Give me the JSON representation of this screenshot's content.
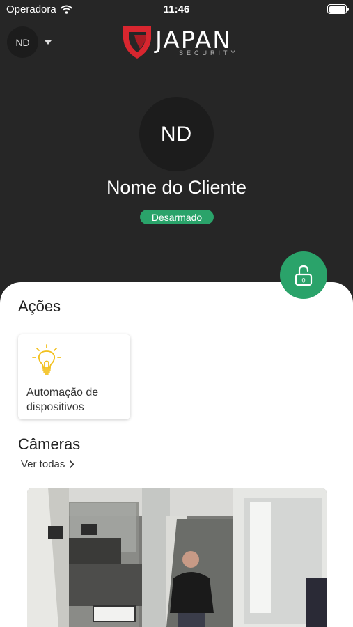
{
  "status_bar": {
    "carrier": "Operadora",
    "time": "11:46"
  },
  "account": {
    "initials": "ND"
  },
  "logo": {
    "name": "JAPAN",
    "tagline": "SECURITY"
  },
  "profile": {
    "initials": "ND",
    "name": "Nome do Cliente",
    "status": "Desarmado"
  },
  "lock_button": {
    "count": "0"
  },
  "actions": {
    "title": "Ações",
    "items": [
      {
        "label": "Automação de dispositivos",
        "icon": "lightbulb-icon"
      }
    ]
  },
  "cameras": {
    "title": "Câmeras",
    "see_all": "Ver todas"
  },
  "colors": {
    "accent": "#2aa36a",
    "header_bg": "#262626",
    "bulb": "#f2c01d",
    "logo_red": "#d8262f"
  }
}
